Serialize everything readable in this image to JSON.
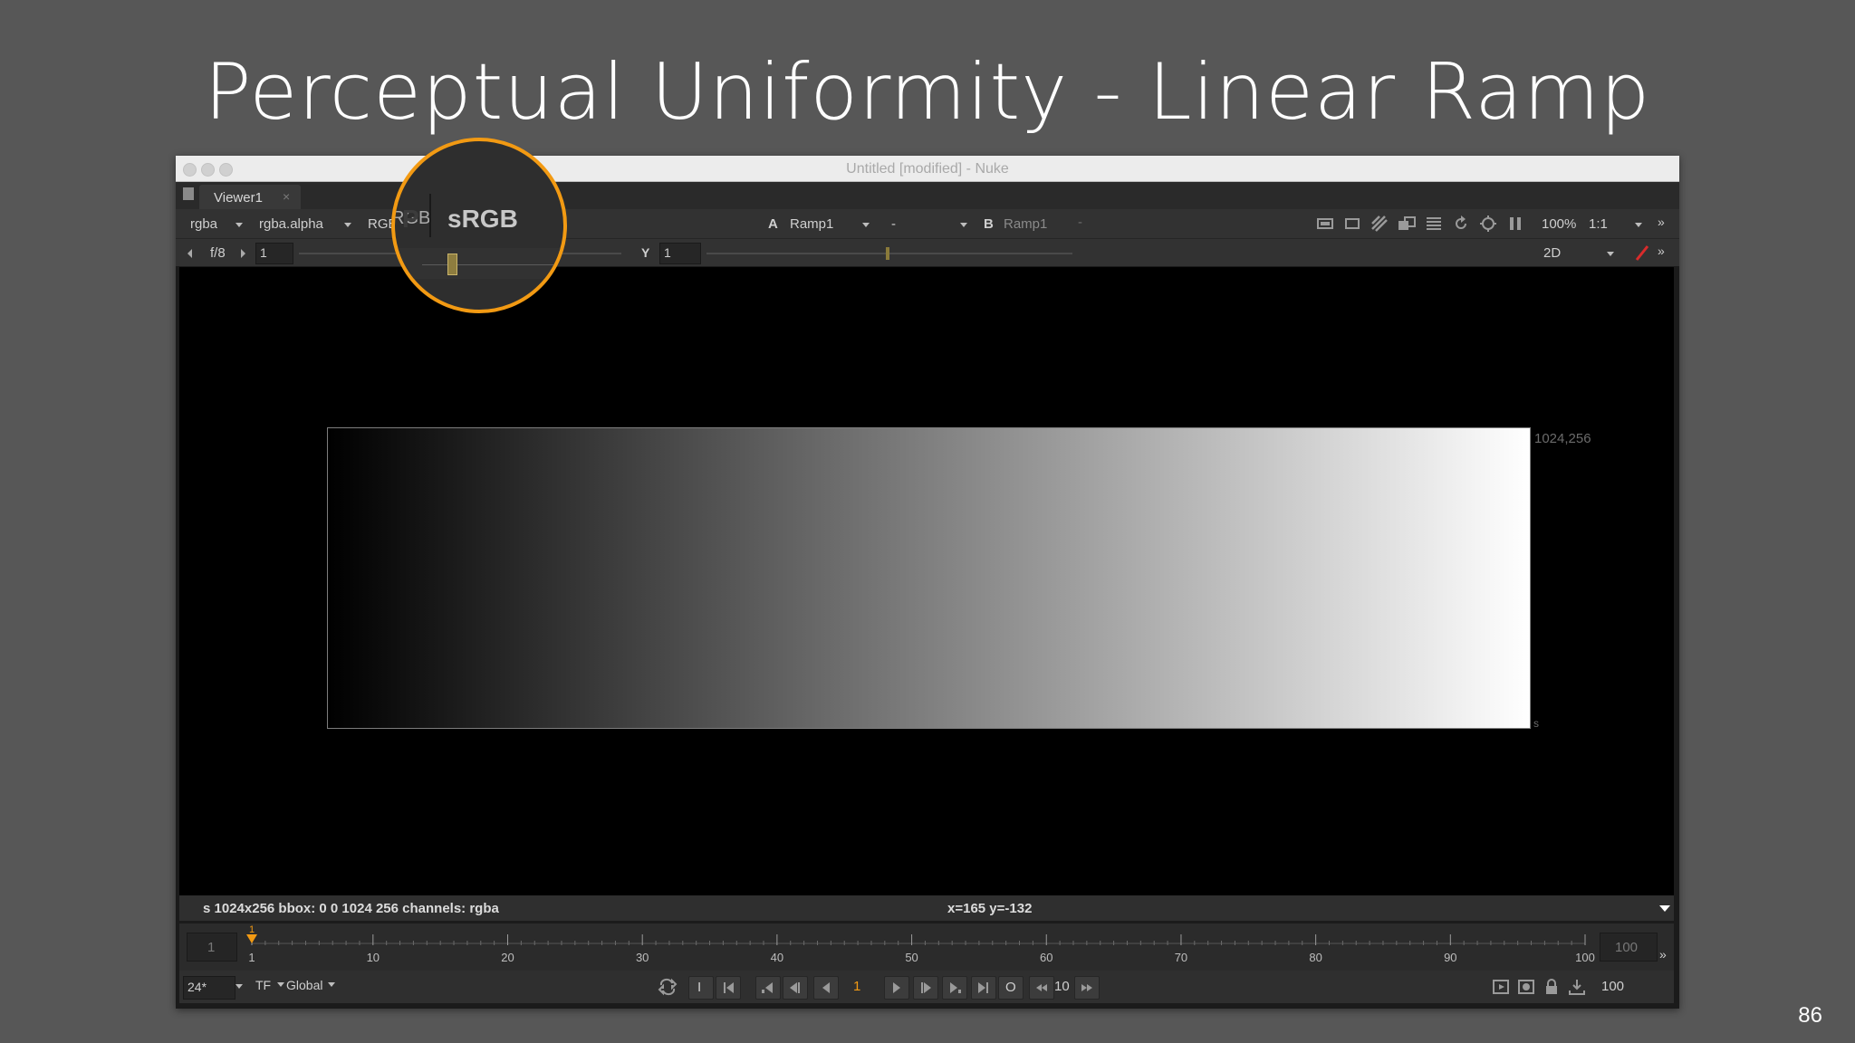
{
  "slide": {
    "title": "Perceptual Uniformity - Linear Ramp",
    "page_number": "86"
  },
  "window": {
    "title": "Untitled [modified] - Nuke"
  },
  "viewer_tab": {
    "label": "Viewer1",
    "close": "×"
  },
  "toolbar1": {
    "channels": "rgba",
    "alpha_channel": "rgba.alpha",
    "display_channels": "RGB",
    "magnified_glyph": "P",
    "colorspace": "sRGB",
    "input_a_label": "A",
    "input_a_node": "Ramp1",
    "compare_mode": "-",
    "input_b_label": "B",
    "input_b_node": "Ramp1",
    "input_b_option": "-",
    "zoom": "100%",
    "ratio": "1:1"
  },
  "toolbar2": {
    "fstop": "f/8",
    "gain_value": "1",
    "gamma_label": "Y",
    "gamma_value": "1",
    "view_mode": "2D"
  },
  "viewer": {
    "format_corner": "1024,256",
    "format_name": "s"
  },
  "infobar": {
    "info": "s 1024x256  bbox: 0 0 1024 256 channels: rgba",
    "coords": "x=165 y=-132"
  },
  "timeline": {
    "in_frame": "1",
    "out_frame": "100",
    "current_marker": "1",
    "ticks": [
      "1",
      "10",
      "20",
      "30",
      "40",
      "50",
      "60",
      "70",
      "80",
      "90",
      "100"
    ]
  },
  "playbar": {
    "fps": "24*",
    "tf": "TF",
    "global": "Global",
    "in_point": "I",
    "current_frame": "1",
    "out_point": "O",
    "step": "10",
    "end_frame": "100"
  },
  "colors": {
    "accent_orange": "#f29a13",
    "background": "#575757",
    "ui_dark": "#323232"
  }
}
